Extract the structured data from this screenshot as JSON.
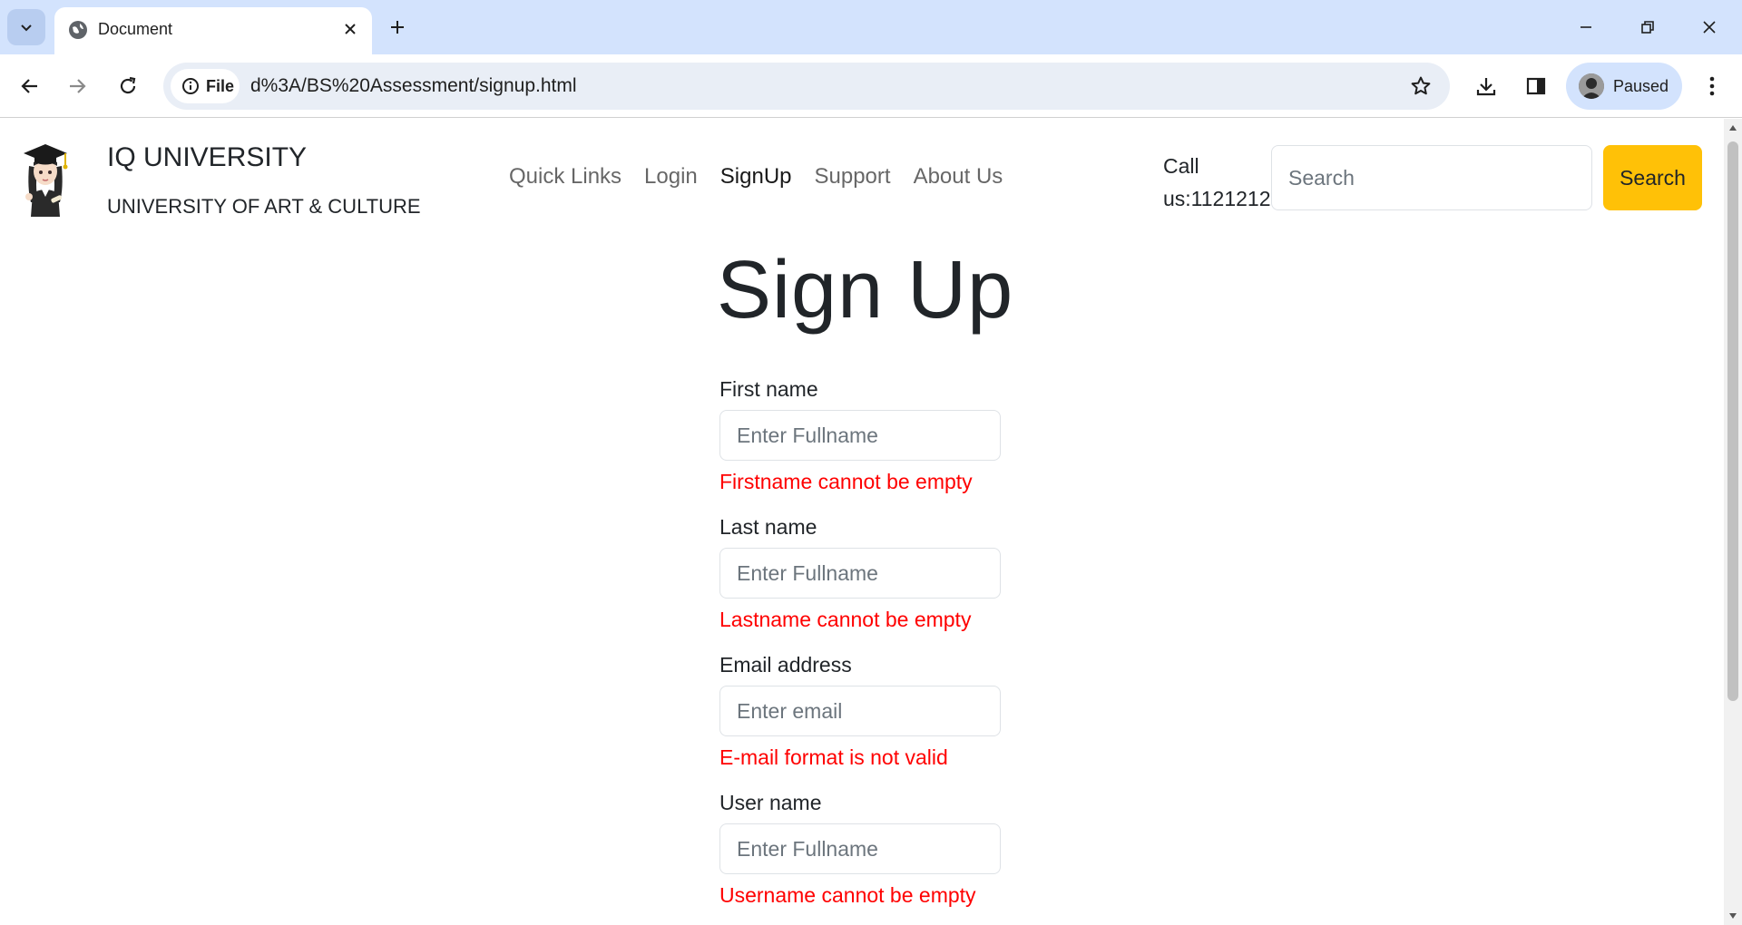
{
  "browser": {
    "tab_title": "Document",
    "site_chip_label": "File",
    "url": "d%3A/BS%20Assessment/signup.html",
    "profile_label": "Paused"
  },
  "site": {
    "brand_title": "IQ UNIVERSITY",
    "brand_subtitle": "UNIVERSITY OF ART & CULTURE",
    "nav": [
      "Quick Links",
      "Login",
      "SignUp",
      "Support",
      "About Us"
    ],
    "active_nav": "SignUp",
    "call_line1": "Call",
    "call_line2": "us:1121212",
    "search_placeholder": "Search",
    "search_button": "Search"
  },
  "form": {
    "heading": "Sign Up",
    "fields": [
      {
        "label": "First name",
        "placeholder": "Enter Fullname",
        "error": "Firstname cannot be empty"
      },
      {
        "label": "Last name",
        "placeholder": "Enter Fullname",
        "error": "Lastname cannot be empty"
      },
      {
        "label": "Email address",
        "placeholder": "Enter email",
        "error": "E-mail format is not valid"
      },
      {
        "label": "User name",
        "placeholder": "Enter Fullname",
        "error": "Username cannot be empty"
      }
    ]
  },
  "colors": {
    "search_button_bg": "#ffc107",
    "error_text": "#ff0000",
    "tabstrip_bg": "#d3e3fd"
  }
}
